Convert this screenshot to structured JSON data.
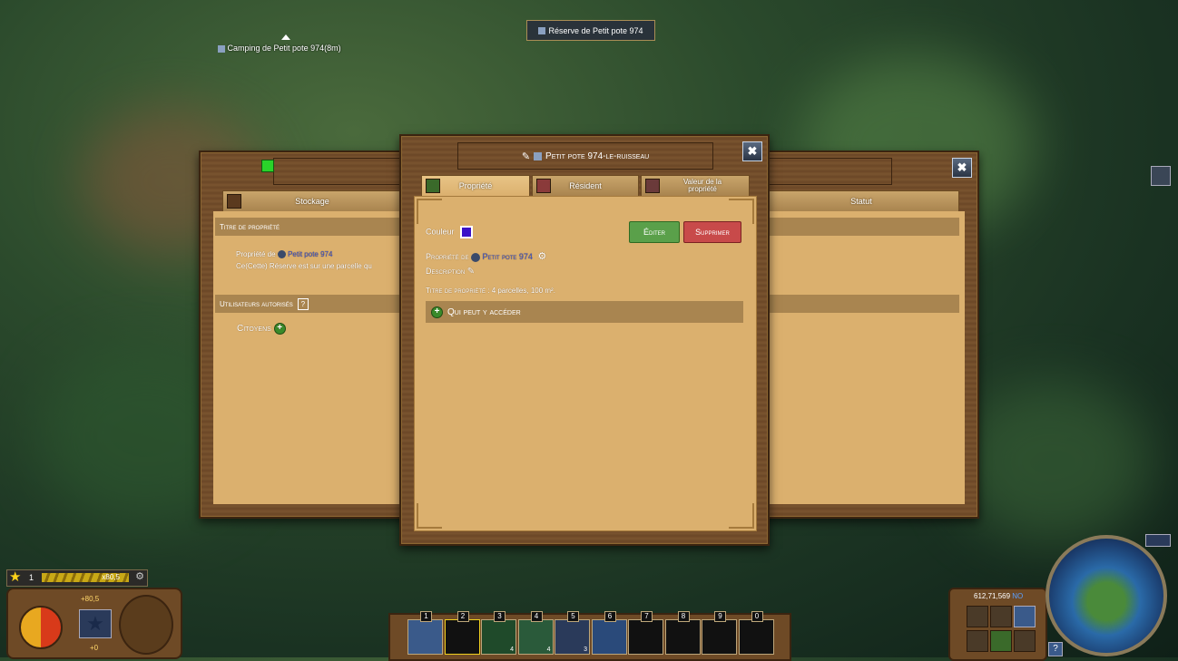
{
  "world": {
    "top_banner": "Réserve de Petit pote 974",
    "camp_marker": "Camping de Petit pote 974(8m)"
  },
  "back_window": {
    "tabs": [
      "Stockage",
      "Statut"
    ],
    "title_section": "Titre de propriété",
    "owner_line": "Propriété de",
    "owner_name": "Petit pote 974",
    "parcel_line": "Ce(Cette) Réserve est sur une parcelle qu",
    "authorized_users": "Utilisateurs autorisés",
    "help_glyph": "?",
    "citizens": "Citoyens"
  },
  "front_window": {
    "title": "Petit pote 974-le-ruisseau",
    "close_glyph": "✖",
    "tabs": [
      {
        "label": "Propriété",
        "icon": "property-tab-icon"
      },
      {
        "label": "Résident",
        "icon": "resident-tab-icon"
      },
      {
        "label": "Valeur de la propriété",
        "icon": "value-tab-icon"
      }
    ],
    "color_label": "Couleur",
    "color_value": "#3a12c8",
    "edit_label": "Éditer",
    "delete_label": "Supprimer",
    "owned_by": "Propriété de",
    "owner_name": "Petit pote 974",
    "description_label": "Description",
    "deed_label": "Titre de propriété :",
    "deed_value": "4 parcelles, 100 m².",
    "access_label": "Qui peut y accéder"
  },
  "hud": {
    "level": "1",
    "xp_text": "x80,5",
    "food_value": "+80,5",
    "bottom_value": "+0",
    "coords": "612,71,569",
    "direction": "NO",
    "help_glyph": "?"
  },
  "hotbar": {
    "slots": [
      {
        "num": "1",
        "count": ""
      },
      {
        "num": "2",
        "count": ""
      },
      {
        "num": "3",
        "count": "4"
      },
      {
        "num": "4",
        "count": "4"
      },
      {
        "num": "5",
        "count": "3"
      },
      {
        "num": "6",
        "count": ""
      },
      {
        "num": "7",
        "count": ""
      },
      {
        "num": "8",
        "count": ""
      },
      {
        "num": "9",
        "count": ""
      },
      {
        "num": "0",
        "count": ""
      }
    ]
  },
  "colors": {
    "accent_green": "#3a8a2a",
    "accent_red": "#c84a4a",
    "link_blue": "#3a52c8"
  }
}
